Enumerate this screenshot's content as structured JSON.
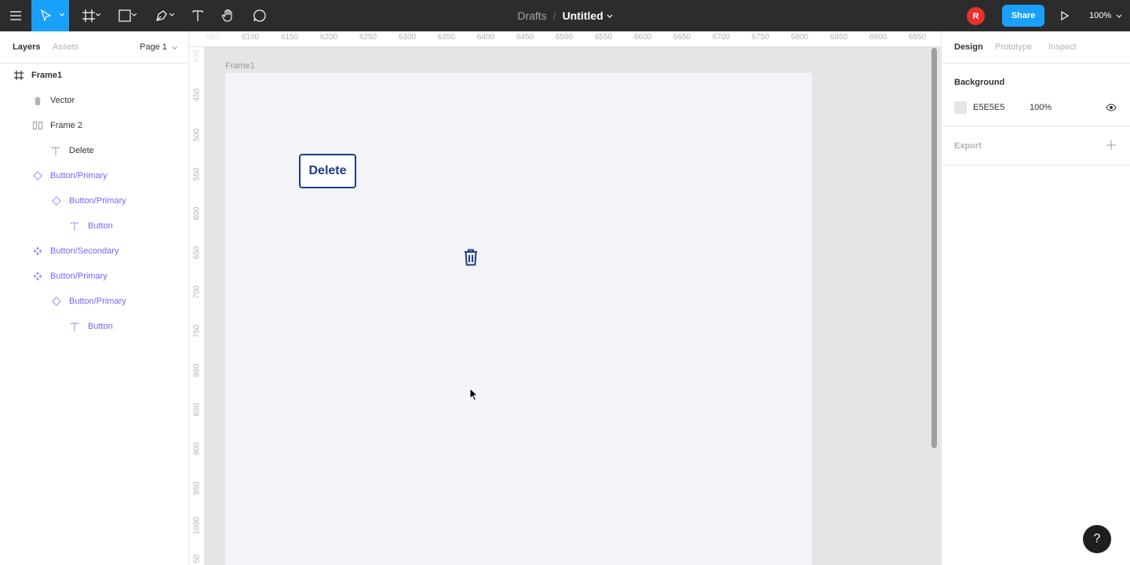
{
  "toolbar": {
    "breadcrumb_drafts": "Drafts",
    "breadcrumb_sep": "/",
    "file_name": "Untitled",
    "avatar_initial": "R",
    "share_label": "Share",
    "zoom_value": "100%",
    "icons": [
      "menu-icon",
      "move-tool-icon",
      "frame-tool-icon",
      "rectangle-tool-icon",
      "pen-tool-icon",
      "text-tool-icon",
      "hand-tool-icon",
      "comment-tool-icon",
      "present-icon"
    ]
  },
  "left_panel": {
    "tabs": [
      "Layers",
      "Assets"
    ],
    "page_select": "Page 1",
    "layers": [
      {
        "name": "Frame1",
        "kind": "frame",
        "icon": "frame-icon"
      },
      {
        "name": "Vector",
        "kind": "plain",
        "icon": "trash-vector-icon"
      },
      {
        "name": "Frame 2",
        "kind": "plain",
        "icon": "auto-layout-icon"
      },
      {
        "name": "Delete",
        "kind": "plain",
        "icon": "text-layer-icon"
      },
      {
        "name": "Button/Primary",
        "kind": "comp",
        "icon": "instance-icon"
      },
      {
        "name": "Button/Primary",
        "kind": "comp",
        "icon": "instance-icon"
      },
      {
        "name": "Button",
        "kind": "comp",
        "icon": "text-layer-icon"
      },
      {
        "name": "Button/Secondary",
        "kind": "comp",
        "icon": "component-icon"
      },
      {
        "name": "Button/Primary",
        "kind": "comp",
        "icon": "component-icon"
      },
      {
        "name": "Button/Primary",
        "kind": "comp",
        "icon": "instance-icon"
      },
      {
        "name": "Button",
        "kind": "comp",
        "icon": "text-layer-icon"
      }
    ]
  },
  "ruler": {
    "top_ticks": [
      "050",
      "6100",
      "6150",
      "6200",
      "6250",
      "6300",
      "6350",
      "6400",
      "6450",
      "6500",
      "6550",
      "6600",
      "6650",
      "6700",
      "6750",
      "6800",
      "6850",
      "6900",
      "6950"
    ],
    "left_ticks": [
      "400",
      "450",
      "500",
      "550",
      "600",
      "650",
      "700",
      "750",
      "800",
      "850",
      "900",
      "950",
      "1000",
      "50"
    ]
  },
  "canvas": {
    "frame_label": "Frame1",
    "delete_button_label": "Delete"
  },
  "right_panel": {
    "tabs": [
      "Design",
      "Prototype",
      "Inspect"
    ],
    "background_title": "Background",
    "background_hex": "E5E5E5",
    "background_opacity": "100%",
    "export_title": "Export"
  },
  "help_label": "?",
  "colors": {
    "toolbar": "#2c2c2c",
    "accent": "#18a0fb",
    "component": "#7b61ff",
    "button_text": "#1d3b8c",
    "frame_fill": "#f3f4f8",
    "canvas": "#e5e5e5"
  }
}
